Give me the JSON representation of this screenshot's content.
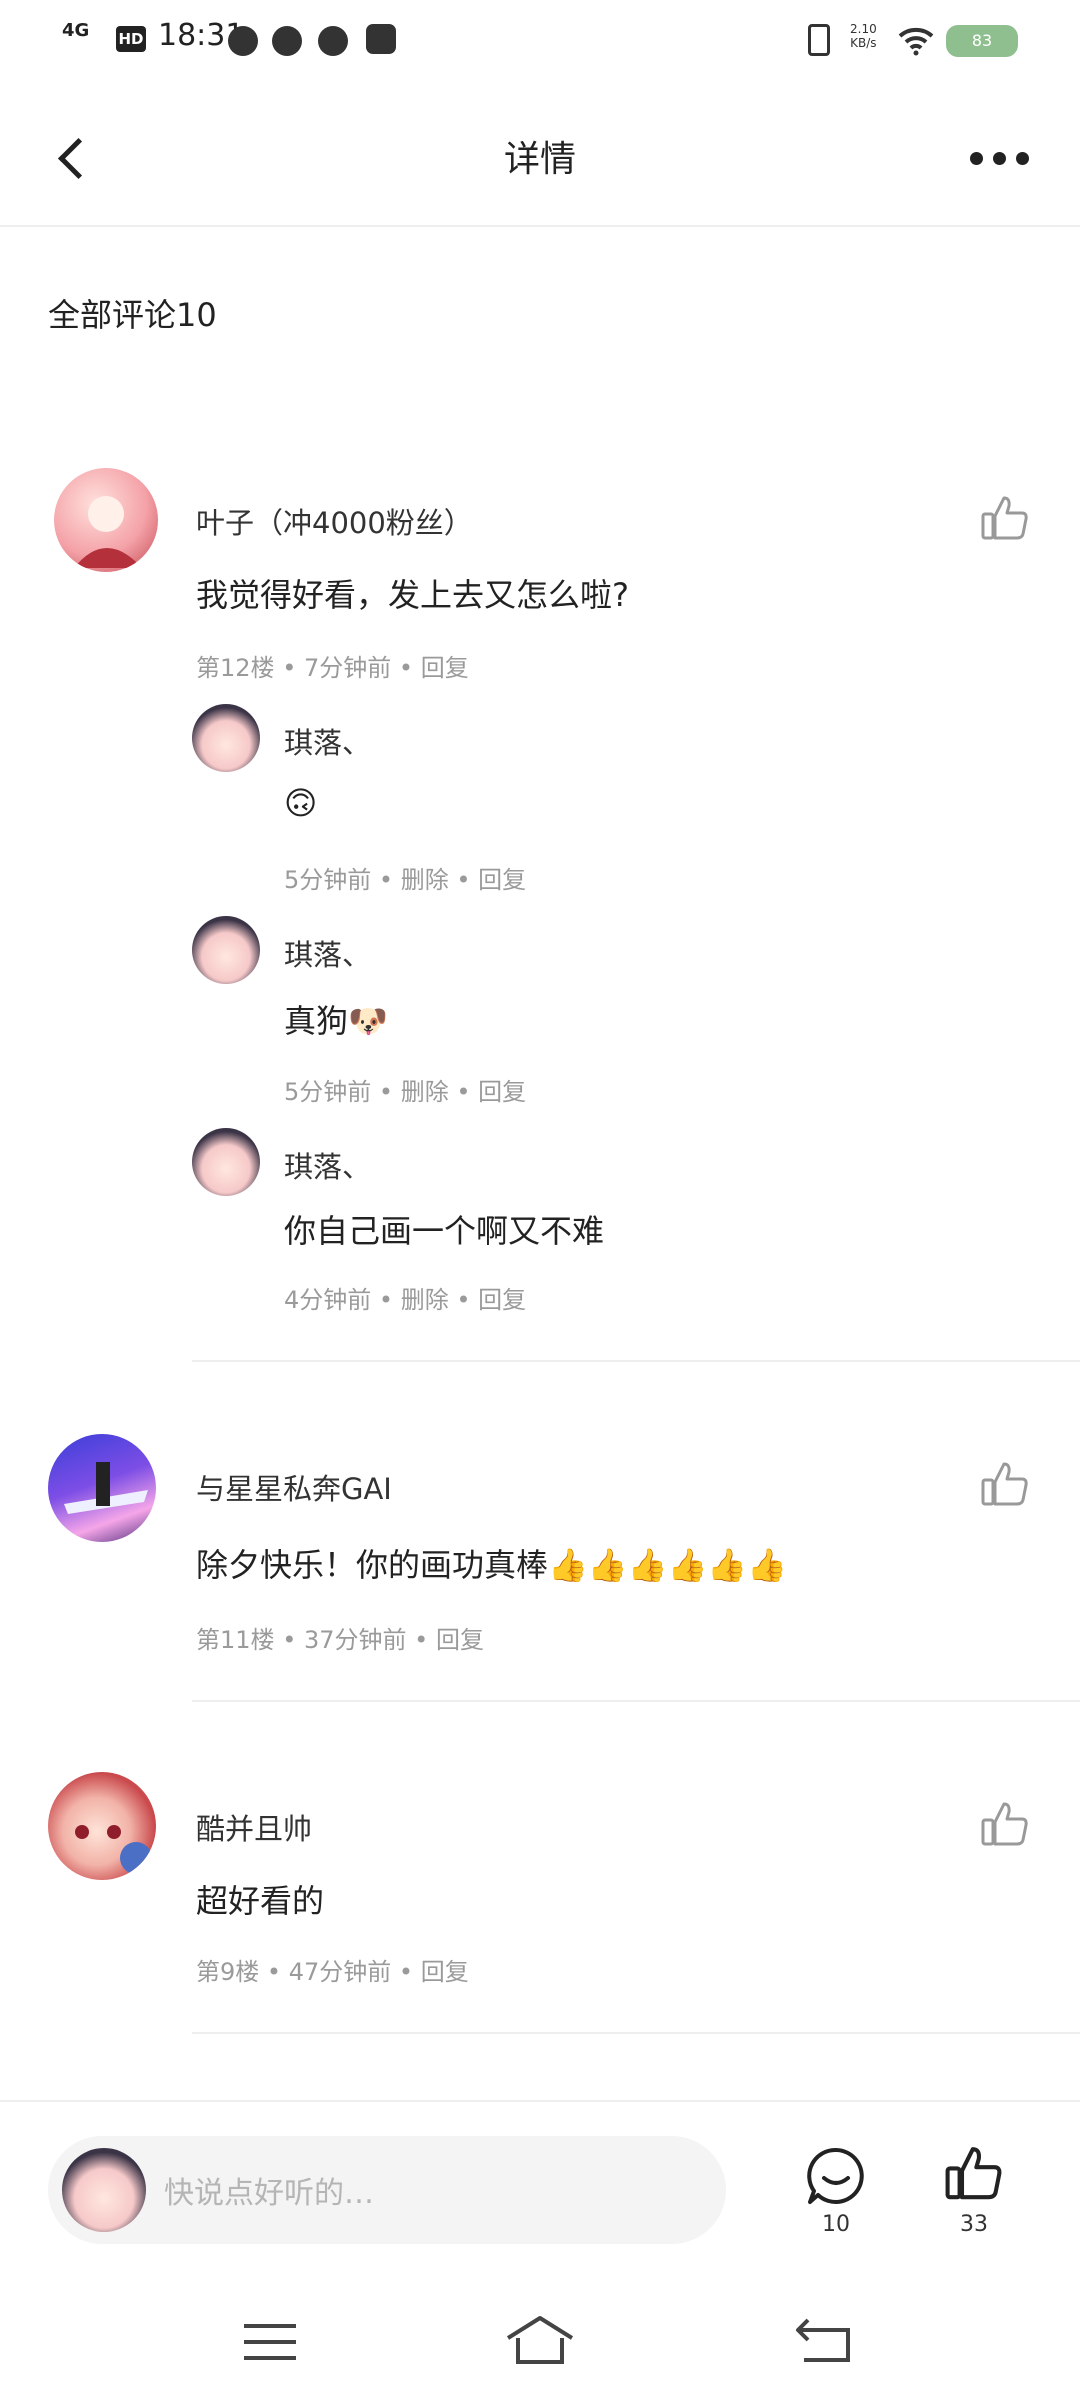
{
  "status_bar": {
    "network": "4G",
    "hd": "HD",
    "time": "18:31",
    "speed_value": "2.10",
    "speed_unit": "KB/s",
    "battery": "83"
  },
  "header": {
    "title": "详情"
  },
  "comments_header": {
    "label": "全部评论10"
  },
  "comments": [
    {
      "author": "叶子（冲4000粉丝）",
      "text": "我觉得好看，发上去又怎么啦?",
      "floor": "第12楼",
      "time": "7分钟前",
      "reply": "回复",
      "replies": [
        {
          "author": "琪落、",
          "text": "🙃",
          "time": "5分钟前",
          "delete": "删除",
          "reply": "回复"
        },
        {
          "author": "琪落、",
          "text": "真狗🐶",
          "time": "5分钟前",
          "delete": "删除",
          "reply": "回复"
        },
        {
          "author": "琪落、",
          "text": "你自己画一个啊又不难",
          "time": "4分钟前",
          "delete": "删除",
          "reply": "回复"
        }
      ]
    },
    {
      "author": "与星星私奔GAI",
      "text": "除夕快乐！你的画功真棒👍👍👍👍👍👍",
      "floor": "第11楼",
      "time": "37分钟前",
      "reply": "回复"
    },
    {
      "author": "酷并且帅",
      "text": "超好看的",
      "floor": "第9楼",
      "time": "47分钟前",
      "reply": "回复"
    }
  ],
  "bottom_bar": {
    "placeholder": "快说点好听的…",
    "comment_count": "10",
    "like_count": "33"
  },
  "colors": {
    "divider": "#eeeeee",
    "meta_text": "#9a9a9a",
    "input_bg": "#f4f4f4"
  }
}
